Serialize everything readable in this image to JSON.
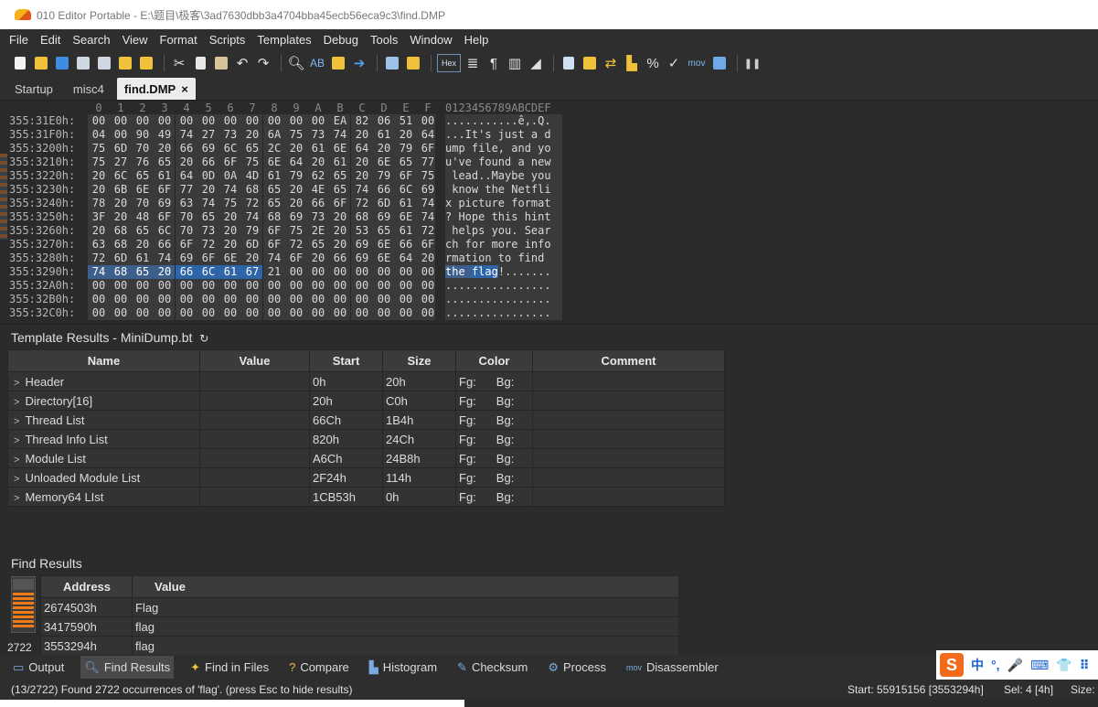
{
  "window": {
    "title": "010 Editor Portable - E:\\题目\\极客\\3ad7630dbb3a4704bba45ecb56eca9c3\\find.DMP"
  },
  "menu": [
    "File",
    "Edit",
    "Search",
    "View",
    "Format",
    "Scripts",
    "Templates",
    "Debug",
    "Tools",
    "Window",
    "Help"
  ],
  "toolbar": {
    "hex_label": "Hex",
    "mov_label": "mov"
  },
  "tabs": [
    {
      "label": "Startup",
      "active": false
    },
    {
      "label": "misc4",
      "active": false
    },
    {
      "label": "find.DMP",
      "active": true,
      "close": "×"
    }
  ],
  "hex_editor": {
    "column_headers": [
      "0",
      "1",
      "2",
      "3",
      "4",
      "5",
      "6",
      "7",
      "8",
      "9",
      "A",
      "B",
      "C",
      "D",
      "E",
      "F"
    ],
    "ascii_header": "0123456789ABCDEF",
    "rows": [
      {
        "addr": "355:31E0h:",
        "bytes": [
          "00",
          "00",
          "00",
          "00",
          "00",
          "00",
          "00",
          "00",
          "00",
          "00",
          "00",
          "EA",
          "82",
          "06",
          "51",
          "00"
        ],
        "ascii": "...........ê‚.Q."
      },
      {
        "addr": "355:31F0h:",
        "bytes": [
          "04",
          "00",
          "90",
          "49",
          "74",
          "27",
          "73",
          "20",
          "6A",
          "75",
          "73",
          "74",
          "20",
          "61",
          "20",
          "64"
        ],
        "ascii": "...It's just a d"
      },
      {
        "addr": "355:3200h:",
        "bytes": [
          "75",
          "6D",
          "70",
          "20",
          "66",
          "69",
          "6C",
          "65",
          "2C",
          "20",
          "61",
          "6E",
          "64",
          "20",
          "79",
          "6F"
        ],
        "ascii": "ump file, and yo"
      },
      {
        "addr": "355:3210h:",
        "bytes": [
          "75",
          "27",
          "76",
          "65",
          "20",
          "66",
          "6F",
          "75",
          "6E",
          "64",
          "20",
          "61",
          "20",
          "6E",
          "65",
          "77"
        ],
        "ascii": "u've found a new"
      },
      {
        "addr": "355:3220h:",
        "bytes": [
          "20",
          "6C",
          "65",
          "61",
          "64",
          "0D",
          "0A",
          "4D",
          "61",
          "79",
          "62",
          "65",
          "20",
          "79",
          "6F",
          "75"
        ],
        "ascii": " lead..Maybe you"
      },
      {
        "addr": "355:3230h:",
        "bytes": [
          "20",
          "6B",
          "6E",
          "6F",
          "77",
          "20",
          "74",
          "68",
          "65",
          "20",
          "4E",
          "65",
          "74",
          "66",
          "6C",
          "69"
        ],
        "ascii": " know the Netfli"
      },
      {
        "addr": "355:3240h:",
        "bytes": [
          "78",
          "20",
          "70",
          "69",
          "63",
          "74",
          "75",
          "72",
          "65",
          "20",
          "66",
          "6F",
          "72",
          "6D",
          "61",
          "74"
        ],
        "ascii": "x picture format"
      },
      {
        "addr": "355:3250h:",
        "bytes": [
          "3F",
          "20",
          "48",
          "6F",
          "70",
          "65",
          "20",
          "74",
          "68",
          "69",
          "73",
          "20",
          "68",
          "69",
          "6E",
          "74"
        ],
        "ascii": "? Hope this hint"
      },
      {
        "addr": "355:3260h:",
        "bytes": [
          "20",
          "68",
          "65",
          "6C",
          "70",
          "73",
          "20",
          "79",
          "6F",
          "75",
          "2E",
          "20",
          "53",
          "65",
          "61",
          "72"
        ],
        "ascii": " helps you. Sear"
      },
      {
        "addr": "355:3270h:",
        "bytes": [
          "63",
          "68",
          "20",
          "66",
          "6F",
          "72",
          "20",
          "6D",
          "6F",
          "72",
          "65",
          "20",
          "69",
          "6E",
          "66",
          "6F"
        ],
        "ascii": "ch for more info"
      },
      {
        "addr": "355:3280h:",
        "bytes": [
          "72",
          "6D",
          "61",
          "74",
          "69",
          "6F",
          "6E",
          "20",
          "74",
          "6F",
          "20",
          "66",
          "69",
          "6E",
          "64",
          "20"
        ],
        "ascii": "rmation to find "
      },
      {
        "addr": "355:3290h:",
        "bytes": [
          "74",
          "68",
          "65",
          "20",
          "66",
          "6C",
          "61",
          "67",
          "21",
          "00",
          "00",
          "00",
          "00",
          "00",
          "00",
          "00"
        ],
        "ascii": "the flag!.......",
        "highlight": [
          0,
          1,
          2,
          3
        ],
        "selected": [
          4,
          5,
          6,
          7
        ]
      },
      {
        "addr": "355:32A0h:",
        "bytes": [
          "00",
          "00",
          "00",
          "00",
          "00",
          "00",
          "00",
          "00",
          "00",
          "00",
          "00",
          "00",
          "00",
          "00",
          "00",
          "00"
        ],
        "ascii": "................"
      },
      {
        "addr": "355:32B0h:",
        "bytes": [
          "00",
          "00",
          "00",
          "00",
          "00",
          "00",
          "00",
          "00",
          "00",
          "00",
          "00",
          "00",
          "00",
          "00",
          "00",
          "00"
        ],
        "ascii": "................"
      },
      {
        "addr": "355:32C0h:",
        "bytes": [
          "00",
          "00",
          "00",
          "00",
          "00",
          "00",
          "00",
          "00",
          "00",
          "00",
          "00",
          "00",
          "00",
          "00",
          "00",
          "00"
        ],
        "ascii": "................"
      }
    ]
  },
  "template_results": {
    "title": "Template Results - MiniDump.bt",
    "refresh_icon": "refresh-icon",
    "columns": [
      "Name",
      "Value",
      "Start",
      "Size",
      "Color",
      "Comment"
    ],
    "rows": [
      {
        "name": "Header",
        "value": "",
        "start": "0h",
        "size": "20h",
        "fg": "Fg:",
        "bg": "Bg:",
        "comment": ""
      },
      {
        "name": "Directory[16]",
        "value": "",
        "start": "20h",
        "size": "C0h",
        "fg": "Fg:",
        "bg": "Bg:",
        "comment": ""
      },
      {
        "name": "Thread List",
        "value": "",
        "start": "66Ch",
        "size": "1B4h",
        "fg": "Fg:",
        "bg": "Bg:",
        "comment": ""
      },
      {
        "name": "Thread Info List",
        "value": "",
        "start": "820h",
        "size": "24Ch",
        "fg": "Fg:",
        "bg": "Bg:",
        "comment": ""
      },
      {
        "name": "Module List",
        "value": "",
        "start": "A6Ch",
        "size": "24B8h",
        "fg": "Fg:",
        "bg": "Bg:",
        "comment": ""
      },
      {
        "name": "Unloaded Module List",
        "value": "",
        "start": "2F24h",
        "size": "114h",
        "fg": "Fg:",
        "bg": "Bg:",
        "comment": ""
      },
      {
        "name": "Memory64 LIst",
        "value": "",
        "start": "1CB53h",
        "size": "0h",
        "fg": "Fg:",
        "bg": "Bg:",
        "comment": ""
      }
    ]
  },
  "find_results": {
    "title": "Find Results",
    "count": "2722",
    "columns": [
      "Address",
      "Value"
    ],
    "rows": [
      {
        "address": "2674503h",
        "value": "Flag"
      },
      {
        "address": "3417590h",
        "value": "flag"
      },
      {
        "address": "3553294h",
        "value": "flag"
      }
    ]
  },
  "bottom_tabs": [
    {
      "label": "Output",
      "icon": "output-icon",
      "active": false
    },
    {
      "label": "Find Results",
      "icon": "find-icon",
      "active": true
    },
    {
      "label": "Find in Files",
      "icon": "find-in-files-icon",
      "active": false
    },
    {
      "label": "Compare",
      "icon": "compare-icon",
      "active": false
    },
    {
      "label": "Histogram",
      "icon": "histogram-icon",
      "active": false
    },
    {
      "label": "Checksum",
      "icon": "checksum-icon",
      "active": false
    },
    {
      "label": "Process",
      "icon": "process-icon",
      "active": false
    },
    {
      "label": "Disassembler",
      "icon": "disassembler-icon",
      "active": false
    }
  ],
  "status": {
    "message": "(13/2722) Found 2722 occurrences of 'flag'. (press Esc to hide results)",
    "start": "Start: 55915156 [3553294h]",
    "sel": "Sel: 4 [4h]",
    "size": "Size:"
  },
  "ime": {
    "logo": "S",
    "items": [
      "中",
      "°,",
      "🎤",
      "⌨",
      "👕",
      "⠿"
    ]
  },
  "colors": {
    "accent_selection": "#2e64a8",
    "find_marker": "#f07a13",
    "background": "#2b2b2b"
  }
}
